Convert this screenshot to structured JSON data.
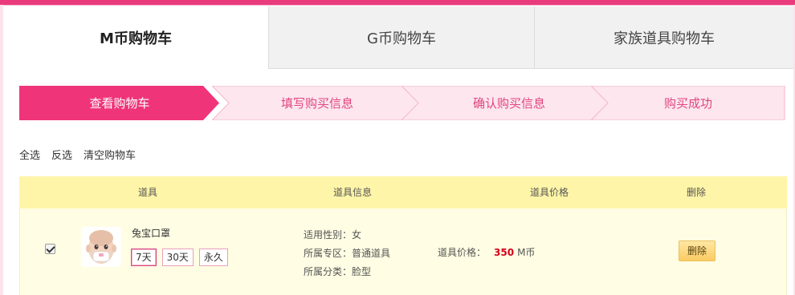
{
  "tabs": [
    {
      "label": "M币购物车"
    },
    {
      "label": "G币购物车"
    },
    {
      "label": "家族道具购物车"
    }
  ],
  "steps": [
    {
      "label": "查看购物车"
    },
    {
      "label": "填写购买信息"
    },
    {
      "label": "确认购买信息"
    },
    {
      "label": "购买成功"
    }
  ],
  "actions": {
    "select_all": "全选",
    "invert": "反选",
    "clear": "清空购物车"
  },
  "table": {
    "headers": [
      "道具",
      "道具信息",
      "道具价格",
      "删除"
    ],
    "rows": [
      {
        "checked": true,
        "name": "兔宝口罩",
        "durations": [
          "7天",
          "30天",
          "永久"
        ],
        "selected_duration": "7天",
        "info": [
          {
            "label": "适用性别：",
            "value": "女"
          },
          {
            "label": "所属专区：",
            "value": "普通道具"
          },
          {
            "label": "所属分类：",
            "value": "脸型"
          }
        ],
        "price_label": "道具价格：",
        "price_value": "350",
        "price_unit": "M币",
        "delete_label": "删除"
      }
    ]
  },
  "colors": {
    "accent": "#e93b7c",
    "step_active": "#f0347a",
    "step_inactive_fill": "#fde6ee",
    "step_inactive_text": "#e0457f",
    "header_bg": "#fff5a8",
    "row_bg": "#fffde3",
    "price_red": "#d6001c"
  }
}
